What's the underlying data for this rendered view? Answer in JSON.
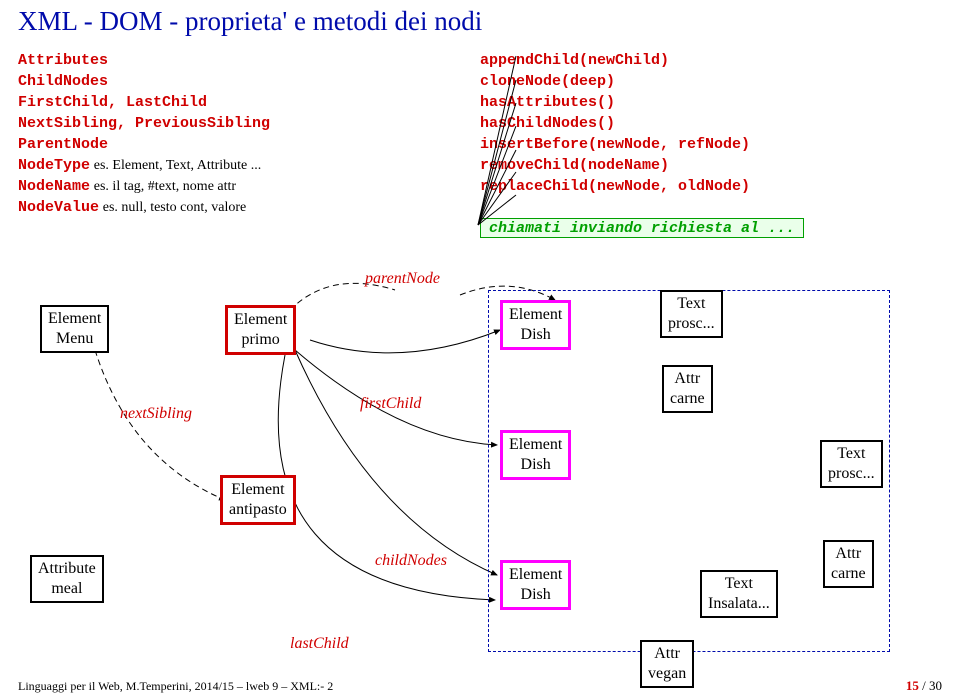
{
  "title": "XML - DOM - proprieta' e metodi dei nodi",
  "props": {
    "Attributes": "Attributes",
    "ChildNodes": "ChildNodes",
    "FirstLast": "FirstChild, LastChild",
    "NextPrev": "NextSibling, PreviousSibling",
    "ParentNode": "ParentNode",
    "NodeType": "NodeType",
    "NodeType_ex": "es. Element, Text, Attribute ...",
    "NodeName": "NodeName",
    "NodeName_ex": "es. il tag,   #text,   nome attr",
    "NodeValue": "NodeValue",
    "NodeValue_ex": "es. null,   testo cont, valore"
  },
  "methods": {
    "append": "appendChild(newChild)",
    "clone": "cloneNode(deep)",
    "hasAttr": "hasAttributes()",
    "hasChild": "hasChildNodes()",
    "insert": "insertBefore(newNode, refNode)",
    "remove": "removeChild(nodeName)",
    "replace": "replaceChild(newNode, oldNode)"
  },
  "note": "chiamati inviando richiesta al ...",
  "nodes": {
    "menu_t": "Element",
    "menu_b": "Menu",
    "primo_t": "Element",
    "primo_b": "primo",
    "antipasto_t": "Element",
    "antipasto_b": "antipasto",
    "dish1_t": "Element",
    "dish1_b": "Dish",
    "dish2_t": "Element",
    "dish2_b": "Dish",
    "dish3_t": "Element",
    "dish3_b": "Dish",
    "attr_meal_t": "Attribute",
    "attr_meal_b": "meal",
    "text1_t": "Text",
    "text1_b": "prosc...",
    "attr_carne1_t": "Attr",
    "attr_carne1_b": "carne",
    "text2_t": "Text",
    "text2_b": "prosc...",
    "text3_t": "Text",
    "text3_b": "Insalata...",
    "attr_carne2_t": "Attr",
    "attr_carne2_b": "carne",
    "attr_vegan_t": "Attr",
    "attr_vegan_b": "vegan"
  },
  "labels": {
    "parentNode": "parentNode",
    "firstChild": "firstChild",
    "childNodes": "childNodes",
    "lastChild": "lastChild",
    "nextSibling": "nextSibling"
  },
  "footer": "Linguaggi per il Web, M.Temperini, 2014/15 – lweb 9 – XML:- 2",
  "page": "15 / 30",
  "page_cur": "15",
  "page_tot": "/ 30"
}
